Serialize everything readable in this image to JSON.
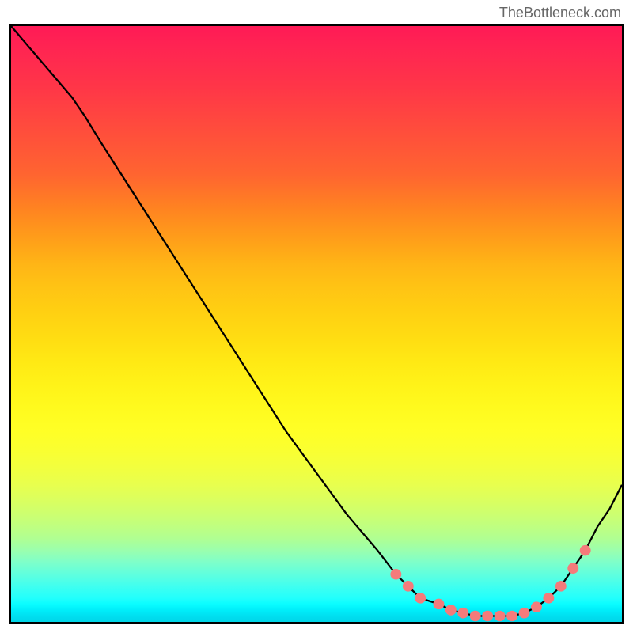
{
  "watermark": "TheBottleneck.com",
  "chart_data": {
    "type": "line",
    "title": "",
    "xlabel": "",
    "ylabel": "",
    "x_range": [
      0,
      100
    ],
    "y_range": [
      0,
      100
    ],
    "series": [
      {
        "name": "curve",
        "x": [
          0,
          5,
          10,
          12,
          15,
          20,
          25,
          30,
          35,
          40,
          45,
          50,
          55,
          60,
          63,
          65,
          67,
          70,
          72,
          74,
          76,
          78,
          80,
          82,
          84,
          86,
          88,
          90,
          92,
          94,
          96,
          98,
          100
        ],
        "y": [
          100,
          94,
          88,
          85,
          80,
          72,
          64,
          56,
          48,
          40,
          32,
          25,
          18,
          12,
          8,
          6,
          4,
          3,
          2,
          1.5,
          1,
          1,
          1,
          1,
          1.5,
          2.5,
          4,
          6,
          9,
          12,
          16,
          19,
          23
        ]
      }
    ],
    "dots": [
      {
        "x": 63,
        "y": 8
      },
      {
        "x": 65,
        "y": 6
      },
      {
        "x": 67,
        "y": 4
      },
      {
        "x": 70,
        "y": 3
      },
      {
        "x": 72,
        "y": 2
      },
      {
        "x": 74,
        "y": 1.5
      },
      {
        "x": 76,
        "y": 1
      },
      {
        "x": 78,
        "y": 1
      },
      {
        "x": 80,
        "y": 1
      },
      {
        "x": 82,
        "y": 1
      },
      {
        "x": 84,
        "y": 1.5
      },
      {
        "x": 86,
        "y": 2.5
      },
      {
        "x": 88,
        "y": 4
      },
      {
        "x": 90,
        "y": 6
      },
      {
        "x": 92,
        "y": 9
      },
      {
        "x": 94,
        "y": 12
      }
    ]
  }
}
